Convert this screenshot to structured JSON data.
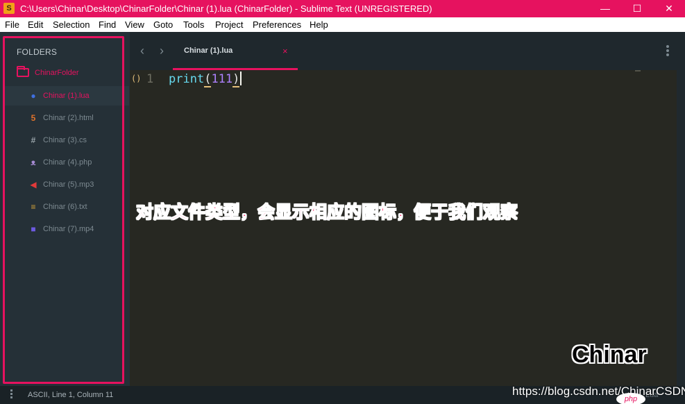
{
  "window": {
    "title": "C:\\Users\\Chinar\\Desktop\\ChinarFolder\\Chinar (1).lua (ChinarFolder) - Sublime Text (UNREGISTERED)",
    "app_icon_glyph": "S",
    "minimize_glyph": "—",
    "maximize_glyph": "☐",
    "close_glyph": "✕",
    "accent_color": "#e6125f"
  },
  "menu": {
    "items": [
      {
        "label": "File"
      },
      {
        "label": "Edit"
      },
      {
        "label": "Selection"
      },
      {
        "label": "Find"
      },
      {
        "label": "View"
      },
      {
        "label": "Goto"
      },
      {
        "label": "Tools"
      },
      {
        "label": "Project"
      },
      {
        "label": "Preferences"
      },
      {
        "label": "Help"
      }
    ]
  },
  "sidebar": {
    "header": "FOLDERS",
    "folder": {
      "label": "ChinarFolder",
      "icon": "folder-icon"
    },
    "files": [
      {
        "label": "Chinar (1).lua",
        "icon": "lua-icon",
        "glyph": "●",
        "color": "#3f6fe0"
      },
      {
        "label": "Chinar (2).html",
        "icon": "html5-icon",
        "glyph": "5",
        "color": "#e0732b"
      },
      {
        "label": "Chinar (3).cs",
        "icon": "hash-icon",
        "glyph": "#",
        "color": "#9aa5ab"
      },
      {
        "label": "Chinar (4).php",
        "icon": "elephant-icon",
        "glyph": "ᴥ",
        "color": "#a78bd4"
      },
      {
        "label": "Chinar (5).mp3",
        "icon": "speaker-icon",
        "glyph": "◀",
        "color": "#e23a3a"
      },
      {
        "label": "Chinar (6).txt",
        "icon": "text-lines-icon",
        "glyph": "≡",
        "color": "#d4a33a"
      },
      {
        "label": "Chinar (7).mp4",
        "icon": "video-camera-icon",
        "glyph": "■",
        "color": "#6d5ae0"
      }
    ]
  },
  "tabs": {
    "back_glyph": "‹",
    "forward_glyph": "›",
    "active": {
      "label": "Chinar (1).lua",
      "close_glyph": "×"
    }
  },
  "editor": {
    "gutter_mark": "()",
    "line_number": "1",
    "code_fn": "print",
    "code_open": "(",
    "code_num": "111",
    "code_close": ")"
  },
  "annotation": {
    "text": "对应文件类型，会显示相应的图标，便于我们观察"
  },
  "brand_watermark": {
    "text": "Chinar"
  },
  "status": {
    "text": "ASCII, Line 1, Column 11",
    "right": "Lua"
  },
  "watermark": {
    "url": "https://blog.csdn.net/ChinarCSDN",
    "php_logo": "php"
  }
}
